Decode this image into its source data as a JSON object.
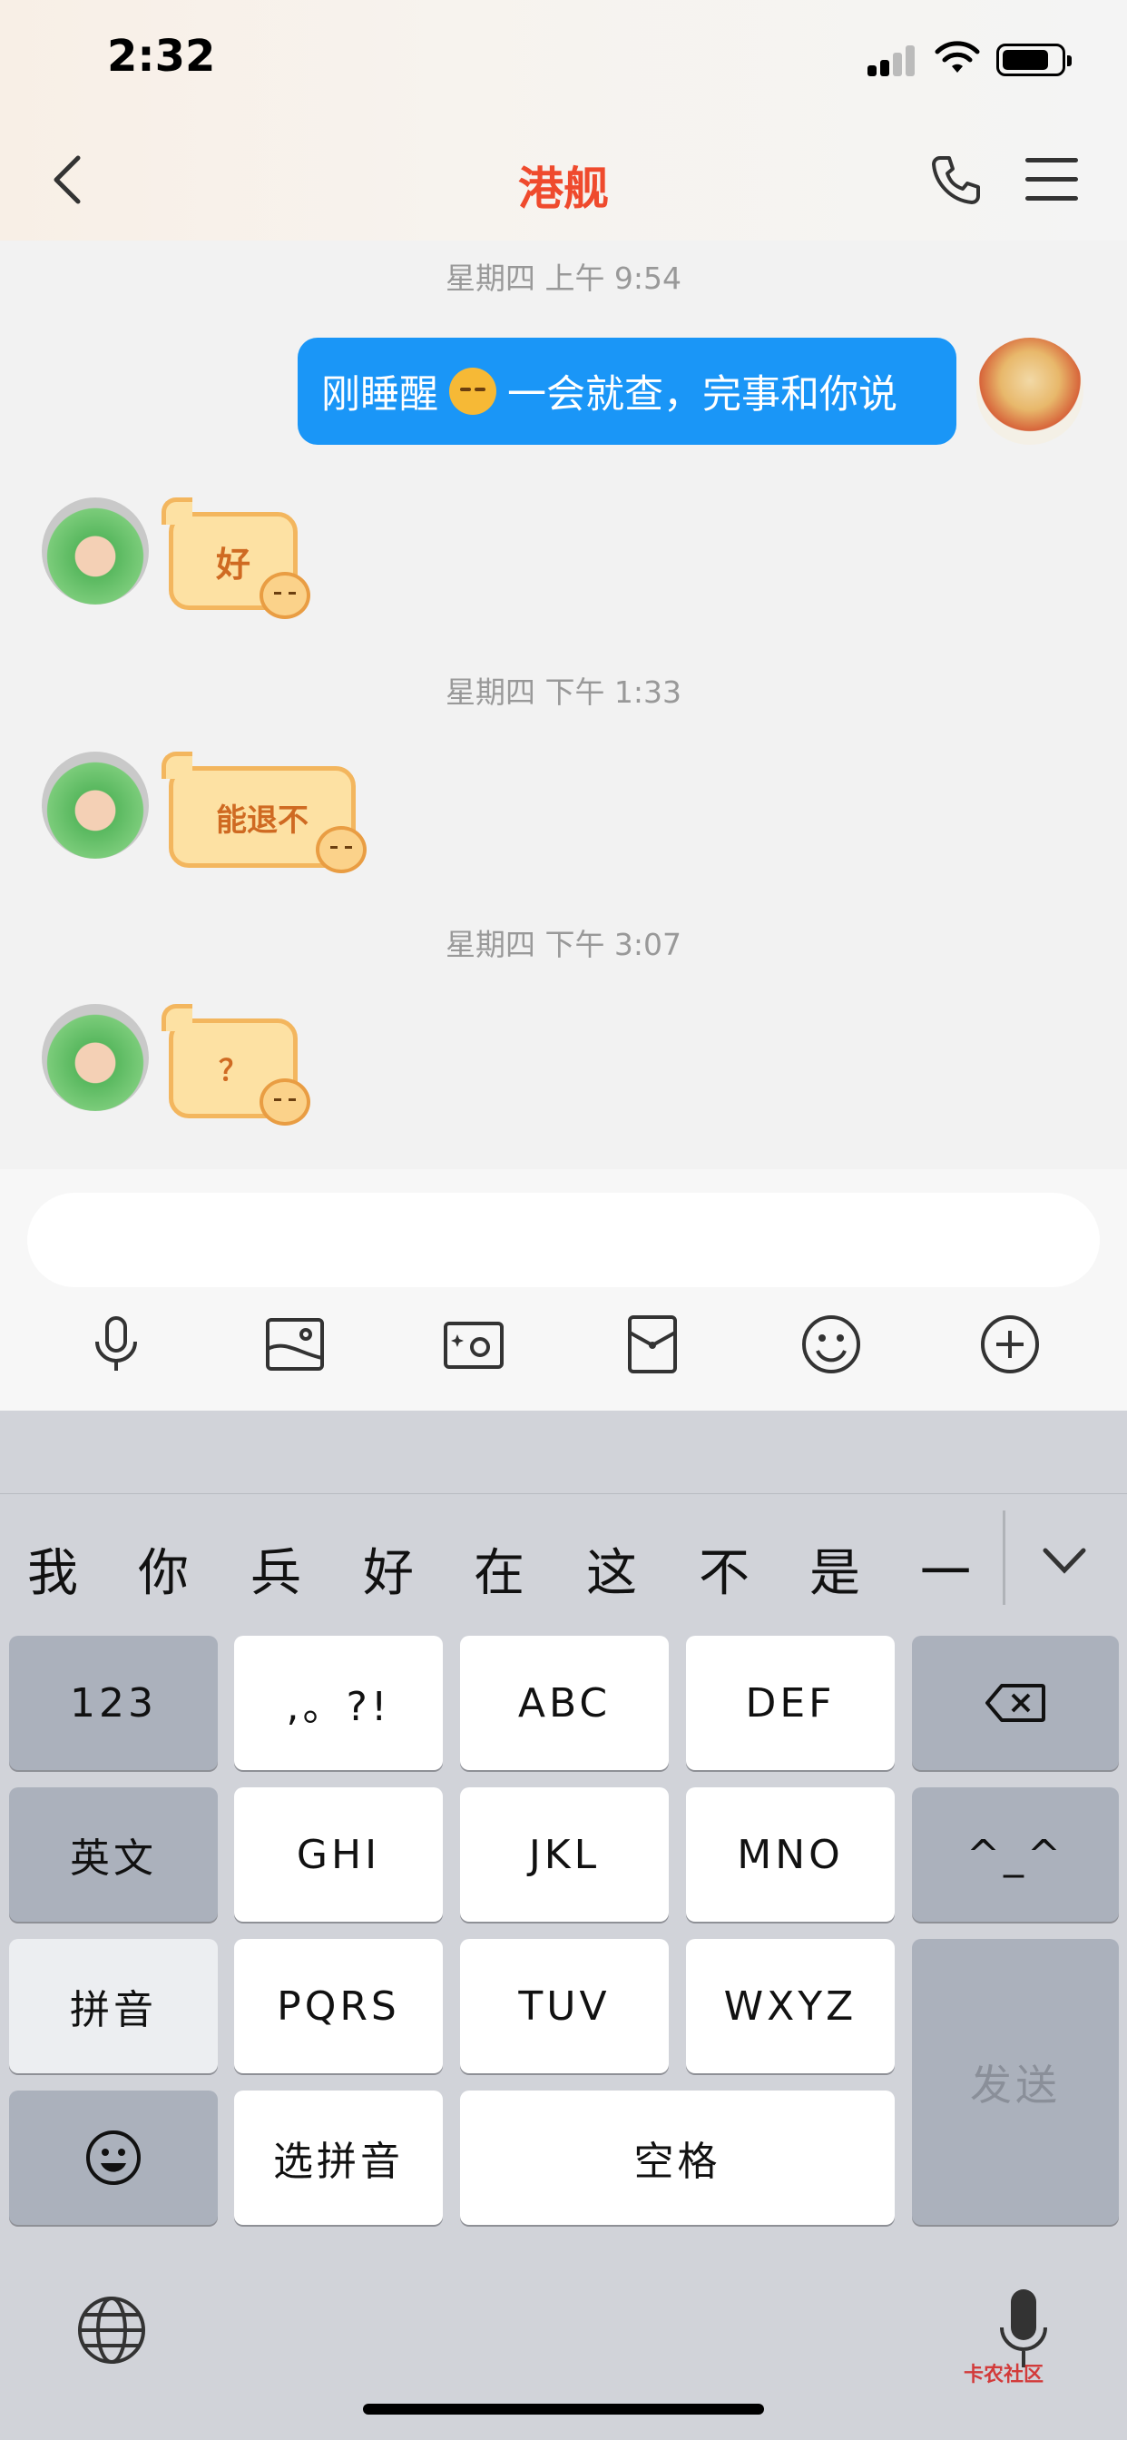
{
  "status_bar": {
    "time": "2:32"
  },
  "nav": {
    "title": "港舰"
  },
  "messages": [
    {
      "timestamp": "星期四 上午 9:54"
    },
    {
      "sender": "me",
      "text_before": "刚睡醒",
      "emoji": "sleepy-face",
      "text_after": "一会就查，完事和你说"
    },
    {
      "sender": "contact",
      "sticker_text": "好"
    },
    {
      "timestamp": "星期四 下午 1:33"
    },
    {
      "sender": "contact",
      "sticker_text": "能退不"
    },
    {
      "timestamp": "星期四 下午 3:07"
    },
    {
      "sender": "contact",
      "sticker_text": "？"
    }
  ],
  "input": {
    "placeholder": ""
  },
  "toolbar": {
    "icons": [
      "microphone-icon",
      "image-icon",
      "camera-icon",
      "red-packet-icon",
      "emoji-icon",
      "plus-icon"
    ]
  },
  "keyboard": {
    "candidates": [
      "我",
      "你",
      "兵",
      "好",
      "在",
      "这",
      "不",
      "是",
      "一"
    ],
    "keys": {
      "num": "123",
      "punct": ",。?!",
      "abc": "ABC",
      "def": "DEF",
      "english": "英文",
      "ghi": "GHI",
      "jkl": "JKL",
      "mno": "MNO",
      "face": "^_^",
      "pinyin": "拼音",
      "pqrs": "PQRS",
      "tuv": "TUV",
      "wxyz": "WXYZ",
      "send": "发送",
      "select_pinyin": "选拼音",
      "space": "空格"
    }
  },
  "watermark": "卡农社区",
  "colors": {
    "accent_title": "#ef4a2d",
    "my_bubble": "#1a96f7",
    "keyboard_bg": "#d1d3d9"
  }
}
